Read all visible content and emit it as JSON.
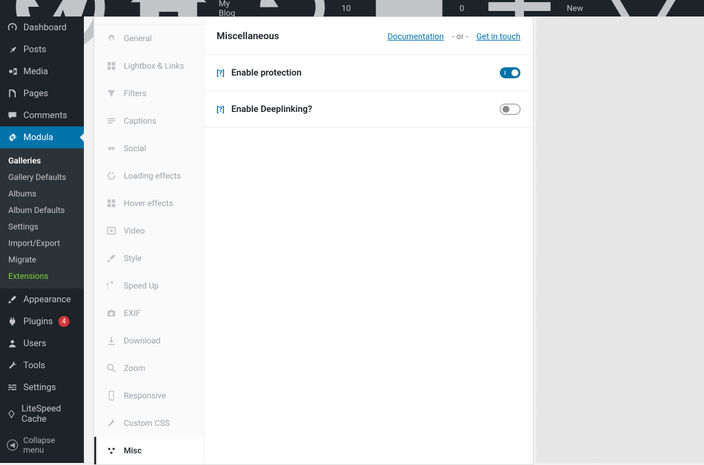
{
  "adminbar": {
    "site_name": "My Blog",
    "refresh_count": "10",
    "comments_count": "0",
    "new_label": "New"
  },
  "sidebar": {
    "dashboard": "Dashboard",
    "posts": "Posts",
    "media": "Media",
    "pages": "Pages",
    "comments": "Comments",
    "modula": "Modula",
    "appearance": "Appearance",
    "plugins": "Plugins",
    "plugins_count": "4",
    "users": "Users",
    "tools": "Tools",
    "settings": "Settings",
    "litespeed": "LiteSpeed Cache",
    "collapse": "Collapse menu"
  },
  "modula_sub": {
    "galleries": "Galleries",
    "gallery_defaults": "Gallery Defaults",
    "albums": "Albums",
    "album_defaults": "Album Defaults",
    "settings": "Settings",
    "import_export": "Import/Export",
    "migrate": "Migrate",
    "extensions": "Extensions"
  },
  "tabs": {
    "general": "General",
    "lightbox": "Lightbox & Links",
    "filters": "Filters",
    "captions": "Captions",
    "social": "Social",
    "loading": "Loading effects",
    "hover": "Hover effects",
    "video": "Video",
    "style": "Style",
    "speedup": "Speed Up",
    "exif": "EXIF",
    "download": "Download",
    "zoom": "Zoom",
    "responsive": "Responsive",
    "customcss": "Custom CSS",
    "misc": "Misc"
  },
  "panel": {
    "title": "Miscellaneous",
    "doc_link": "Documentation",
    "or_text": "- or -",
    "contact_link": "Get in touch",
    "help_text": "[?]",
    "settings": [
      {
        "label": "Enable protection",
        "enabled": true
      },
      {
        "label": "Enable Deeplinking?",
        "enabled": false
      }
    ]
  }
}
